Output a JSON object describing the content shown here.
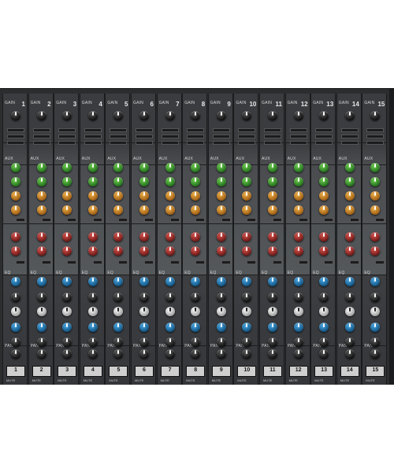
{
  "channels": [
    {
      "num": "1",
      "mute": "1"
    },
    {
      "num": "2",
      "mute": "2"
    },
    {
      "num": "3",
      "mute": "3"
    },
    {
      "num": "4",
      "mute": "4"
    },
    {
      "num": "5",
      "mute": "5"
    },
    {
      "num": "6",
      "mute": "6"
    },
    {
      "num": "7",
      "mute": "7"
    },
    {
      "num": "8",
      "mute": "8"
    },
    {
      "num": "9",
      "mute": "9"
    },
    {
      "num": "10",
      "mute": "10"
    },
    {
      "num": "11",
      "mute": "11"
    },
    {
      "num": "12",
      "mute": "12"
    },
    {
      "num": "13",
      "mute": "13"
    },
    {
      "num": "14",
      "mute": "14"
    },
    {
      "num": "15",
      "mute": "15"
    }
  ],
  "labels": {
    "gain": "GAIN",
    "aux": "AUX",
    "eq": "EQ",
    "pan": "PAN",
    "mute": "MUTE"
  },
  "colors": {
    "panel": "#2b2d2f",
    "aux_knob_1": "#3fa83a",
    "aux_knob_2": "#e39a2c",
    "aux_knob_3": "#b8302c",
    "eq_knob": "#2b8bd0",
    "eq_mid_knob": "#ffffff"
  }
}
